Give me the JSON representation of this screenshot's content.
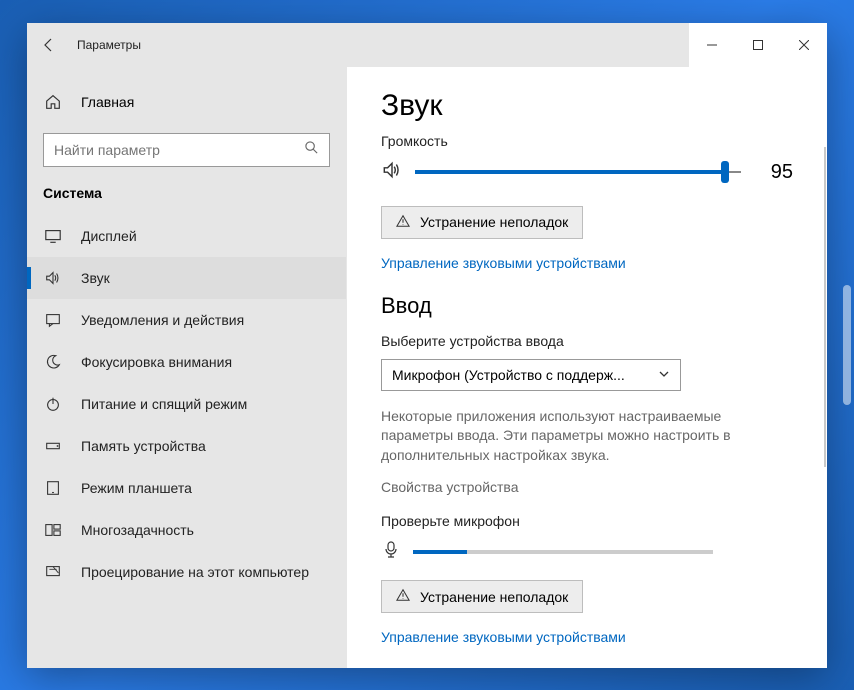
{
  "title": "Параметры",
  "home": "Главная",
  "search_placeholder": "Найти параметр",
  "section": "Система",
  "nav": [
    {
      "label": "Дисплей"
    },
    {
      "label": "Звук"
    },
    {
      "label": "Уведомления и действия"
    },
    {
      "label": "Фокусировка внимания"
    },
    {
      "label": "Питание и спящий режим"
    },
    {
      "label": "Память устройства"
    },
    {
      "label": "Режим планшета"
    },
    {
      "label": "Многозадачность"
    },
    {
      "label": "Проецирование на этот компьютер"
    }
  ],
  "main": {
    "title": "Звук",
    "volume_label": "Громкость",
    "volume": 95,
    "troubleshoot": "Устранение неполадок",
    "manage_link": "Управление звуковыми устройствами",
    "input_title": "Ввод",
    "input_choose": "Выберите устройства ввода",
    "input_device": "Микрофон (Устройство с поддерж...",
    "input_desc": "Некоторые приложения используют настраиваемые параметры ввода. Эти параметры можно настроить в дополнительных настройках звука.",
    "device_props": "Свойства устройства",
    "test_mic": "Проверьте микрофон",
    "mic_level": 18,
    "troubleshoot2": "Устранение неполадок",
    "manage_link2": "Управление звуковыми устройствами"
  }
}
